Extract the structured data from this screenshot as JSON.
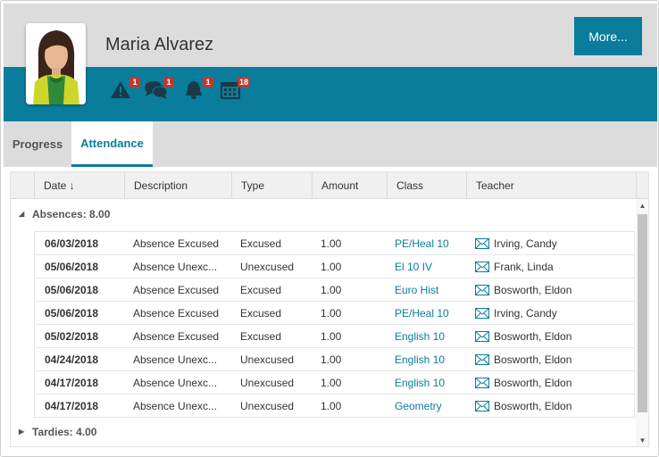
{
  "student": {
    "name": "Maria Alvarez"
  },
  "header": {
    "more_label": "More..."
  },
  "notifications": [
    {
      "icon": "warning-icon",
      "count": "1"
    },
    {
      "icon": "chat-bubbles-icon",
      "count": "1"
    },
    {
      "icon": "bell-icon",
      "count": "1"
    },
    {
      "icon": "calendar-icon",
      "count": "18"
    }
  ],
  "tabs": [
    {
      "label": "Progress",
      "active": false
    },
    {
      "label": "Attendance",
      "active": true
    }
  ],
  "table": {
    "columns": [
      "Date",
      "Description",
      "Type",
      "Amount",
      "Class",
      "Teacher"
    ],
    "sort_indicator": "↓",
    "groups": {
      "absences": "Absences: 8.00",
      "tardies": "Tardies: 4.00"
    },
    "rows": [
      {
        "date": "06/03/2018",
        "description": "Absence Excused",
        "type": "Excused",
        "amount": "1.00",
        "class": "PE/Heal 10",
        "teacher": "Irving, Candy"
      },
      {
        "date": "05/06/2018",
        "description": "Absence Unexc...",
        "type": "Unexcused",
        "amount": "1.00",
        "class": "El 10 IV",
        "teacher": "Frank, Linda"
      },
      {
        "date": "05/06/2018",
        "description": "Absence Excused",
        "type": "Excused",
        "amount": "1.00",
        "class": "Euro Hist",
        "teacher": "Bosworth, Eldon"
      },
      {
        "date": "05/06/2018",
        "description": "Absence Excused",
        "type": "Excused",
        "amount": "1.00",
        "class": "PE/Heal 10",
        "teacher": "Irving, Candy"
      },
      {
        "date": "05/02/2018",
        "description": "Absence Excused",
        "type": "Excused",
        "amount": "1.00",
        "class": "English 10",
        "teacher": "Bosworth, Eldon"
      },
      {
        "date": "04/24/2018",
        "description": "Absence Unexc...",
        "type": "Unexcused",
        "amount": "1.00",
        "class": "English 10",
        "teacher": "Bosworth, Eldon"
      },
      {
        "date": "04/17/2018",
        "description": "Absence Unexc...",
        "type": "Unexcused",
        "amount": "1.00",
        "class": "English 10",
        "teacher": "Bosworth, Eldon"
      },
      {
        "date": "04/17/2018",
        "description": "Absence Unexc...",
        "type": "Unexcused",
        "amount": "1.00",
        "class": "Geometry",
        "teacher": "Bosworth, Eldon"
      }
    ]
  },
  "colors": {
    "accent": "#0a7c9c",
    "badge": "#c0392b",
    "header_bg": "#dcdcdc"
  }
}
